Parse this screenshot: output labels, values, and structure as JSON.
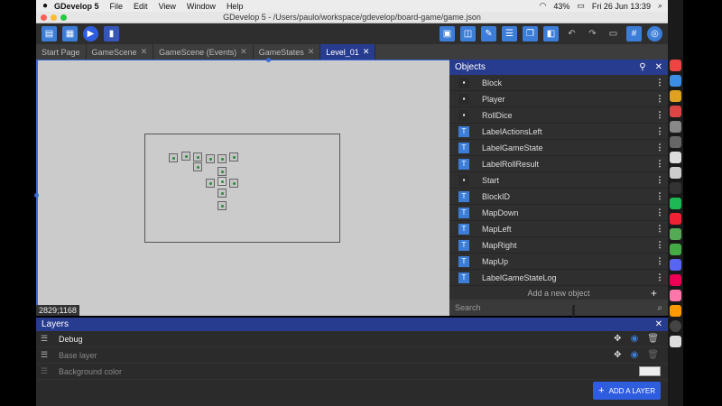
{
  "menubar": {
    "app_name": "GDevelop 5",
    "items": [
      "File",
      "Edit",
      "View",
      "Window",
      "Help"
    ],
    "battery": "43%",
    "datetime": "Fri 26 Jun  13:39"
  },
  "window": {
    "title": "GDevelop 5 - /Users/paulo/workspace/gdevelop/board-game/game.json"
  },
  "tabs": [
    {
      "label": "Start Page",
      "closable": false
    },
    {
      "label": "GameScene",
      "closable": true
    },
    {
      "label": "GameScene (Events)",
      "closable": true
    },
    {
      "label": "GameStates",
      "closable": true
    },
    {
      "label": "Level_01",
      "closable": true,
      "active": true
    }
  ],
  "scene": {
    "cursor_coords": "2829;1168"
  },
  "objects_panel": {
    "title": "Objects",
    "items": [
      {
        "name": "Block",
        "icon": "sprite-icon"
      },
      {
        "name": "Player",
        "icon": "sprite-icon"
      },
      {
        "name": "RollDice",
        "icon": "sprite-icon"
      },
      {
        "name": "LabelActionsLeft",
        "icon": "text-icon"
      },
      {
        "name": "LabelGameState",
        "icon": "text-icon"
      },
      {
        "name": "LabelRollResult",
        "icon": "text-icon"
      },
      {
        "name": "Start",
        "icon": "sprite-icon"
      },
      {
        "name": "BlockID",
        "icon": "text-icon"
      },
      {
        "name": "MapDown",
        "icon": "text-icon"
      },
      {
        "name": "MapLeft",
        "icon": "text-icon"
      },
      {
        "name": "MapRight",
        "icon": "text-icon"
      },
      {
        "name": "MapUp",
        "icon": "text-icon"
      },
      {
        "name": "LabelGameStateLog",
        "icon": "text-icon"
      }
    ],
    "add_label": "Add a new object",
    "search_placeholder": "Search"
  },
  "layers_panel": {
    "title": "Layers",
    "layers": [
      {
        "name": "Debug",
        "dim": false
      },
      {
        "name": "Base layer",
        "dim": true
      }
    ],
    "background_label": "Background color",
    "background_color": "#eeeeee",
    "add_button": "ADD A LAYER"
  },
  "colors": {
    "accent": "#283c8f",
    "button": "#2f5de0"
  }
}
